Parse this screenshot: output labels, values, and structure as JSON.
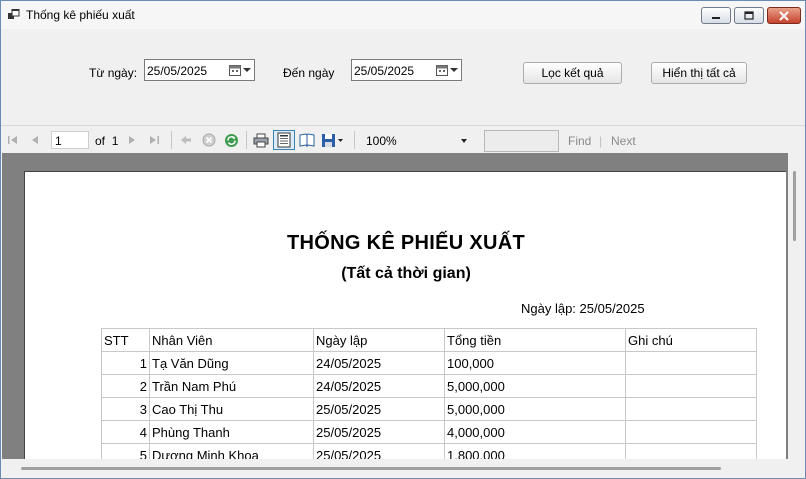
{
  "window": {
    "title": "Thống kê phiếu xuất"
  },
  "filter": {
    "from_label": "Từ ngày:",
    "from_value": "25/05/2025",
    "to_label": "Đến ngày",
    "to_value": "25/05/2025",
    "filter_button": "Lọc kết quả",
    "show_all_button": "Hiển thị tất cả"
  },
  "toolbar": {
    "page_current": "1",
    "page_of": "of",
    "page_total": "1",
    "zoom": "100%",
    "find_text": "",
    "find_label": "Find",
    "separator": "|",
    "next_label": "Next"
  },
  "report": {
    "title": "THỐNG KÊ PHIẾU XUẤT",
    "subtitle": "(Tất cả thời gian)",
    "created": "Ngày lập: 25/05/2025",
    "headers": [
      "STT",
      "Nhân Viên",
      "Ngày lập",
      "Tổng tiền",
      "Ghi chú"
    ],
    "rows": [
      [
        "1",
        "Tạ Văn Dũng",
        "24/05/2025",
        "100,000",
        ""
      ],
      [
        "2",
        "Trần Nam Phú",
        "24/05/2025",
        "5,000,000",
        ""
      ],
      [
        "3",
        "Cao Thị Thu",
        "25/05/2025",
        "5,000,000",
        ""
      ],
      [
        "4",
        "Phùng Thanh",
        "25/05/2025",
        "4,000,000",
        ""
      ],
      [
        "5",
        "Dương Minh Khoa",
        "25/05/2025",
        "1,800,000",
        ""
      ]
    ]
  }
}
